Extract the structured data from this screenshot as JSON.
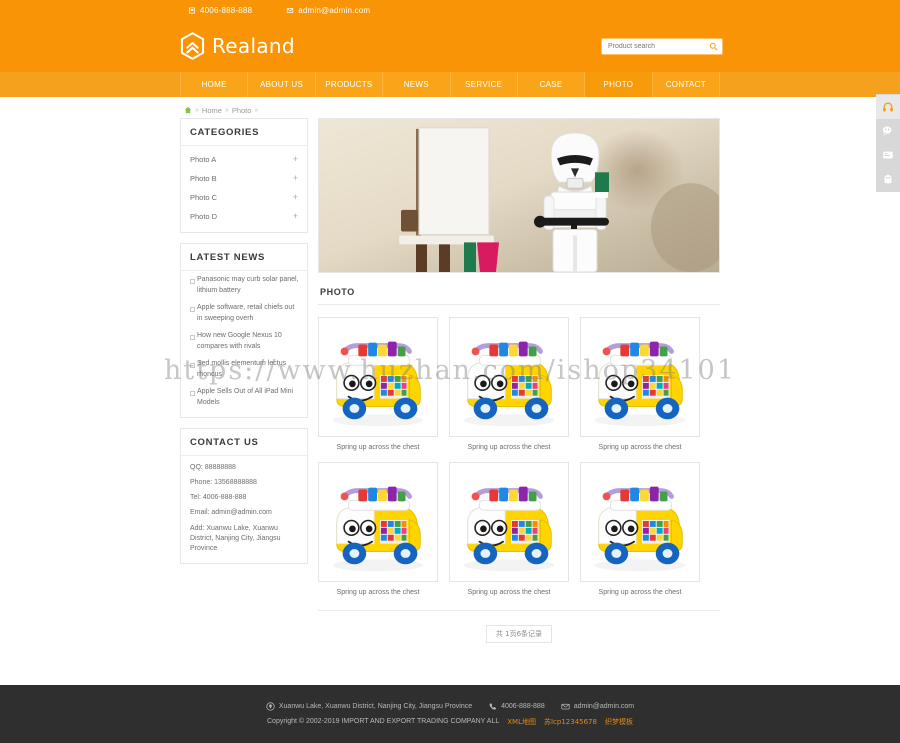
{
  "topbar": {
    "phone": "4006-888-888",
    "email": "admin@admin.com",
    "phone_icon": "phone-icon",
    "email_icon": "mail-icon"
  },
  "header": {
    "logo_text": "Realand",
    "logo_icon": "hexagon-chevron-logo",
    "search": {
      "placeholder": "Product search",
      "value": "",
      "icon": "search-icon"
    }
  },
  "nav": {
    "items": [
      {
        "label": "HOME",
        "active": false
      },
      {
        "label": "ABOUT US",
        "active": false
      },
      {
        "label": "PRODUCTS",
        "active": false
      },
      {
        "label": "NEWS",
        "active": false
      },
      {
        "label": "SERVICE",
        "active": false
      },
      {
        "label": "CASE",
        "active": false
      },
      {
        "label": "PHOTO",
        "active": true
      },
      {
        "label": "CONTACT",
        "active": false
      }
    ]
  },
  "breadcrumb": {
    "home_icon": "home-icon",
    "sep": "»",
    "items": [
      "Home",
      "Photo"
    ]
  },
  "sidebar": {
    "categories": {
      "title": "CATEGORIES",
      "items": [
        {
          "label": "Photo A",
          "expand": "+"
        },
        {
          "label": "Photo B",
          "expand": "+"
        },
        {
          "label": "Photo C",
          "expand": "+"
        },
        {
          "label": "Photo D",
          "expand": "+"
        }
      ]
    },
    "latest_news": {
      "title": "LATEST NEWS",
      "items": [
        "Panasonic may curb solar panel, lithium battery",
        "Apple software, retail chiefs out in sweeping overh",
        "How new Google Nexus 10 compares with rivals",
        "Sed mollis elementum lectus rhoncus",
        "Apple Sells Out of All iPad Mini Models"
      ]
    },
    "contact": {
      "title": "CONTACT US",
      "lines": [
        "QQ: 88888888",
        "Phone: 13568888888",
        "Tel: 4006-888-888",
        "Email: admin@admin.com",
        "Add: Xuanwu Lake, Xuanwu District, Nanjing City, Jiangsu Province"
      ]
    }
  },
  "main": {
    "banner_alt": "stormtrooper-lego-banner",
    "section_title": "PHOTO",
    "items": [
      {
        "caption": "Spring up across the chest"
      },
      {
        "caption": "Spring up across the chest"
      },
      {
        "caption": "Spring up across the chest"
      },
      {
        "caption": "Spring up across the chest"
      },
      {
        "caption": "Spring up across the chest"
      },
      {
        "caption": "Spring up across the chest"
      }
    ],
    "pager_label": "共 1页6条记录"
  },
  "float_bar": {
    "buttons": [
      {
        "icon": "headset-icon"
      },
      {
        "icon": "wechat-icon"
      },
      {
        "icon": "message-icon"
      },
      {
        "icon": "qq-penguin-icon"
      }
    ]
  },
  "footer": {
    "address": "Xuanwu Lake, Xuanwu District, Nanjing City, Jiangsu Province",
    "phone": "4006-888-888",
    "email": "admin@admin.com",
    "address_icon": "location-pin-icon",
    "phone_icon": "phone-handset-icon",
    "email_icon": "envelope-icon",
    "copyright": "Copyright © 2002-2019 IMPORT AND EXPORT TRADING COMPANY  ALL",
    "link_xml": "XML地图",
    "link_icp": "苏Icp12345678",
    "link_tpl": "织梦模板"
  },
  "watermark": {
    "text": "https://www.huzhan.com/ishop34101"
  },
  "colors": {
    "brand_orange": "#f89406",
    "nav_orange": "#faa419",
    "footer_dark": "#2f2f2f",
    "link_orange": "#e08b12"
  }
}
